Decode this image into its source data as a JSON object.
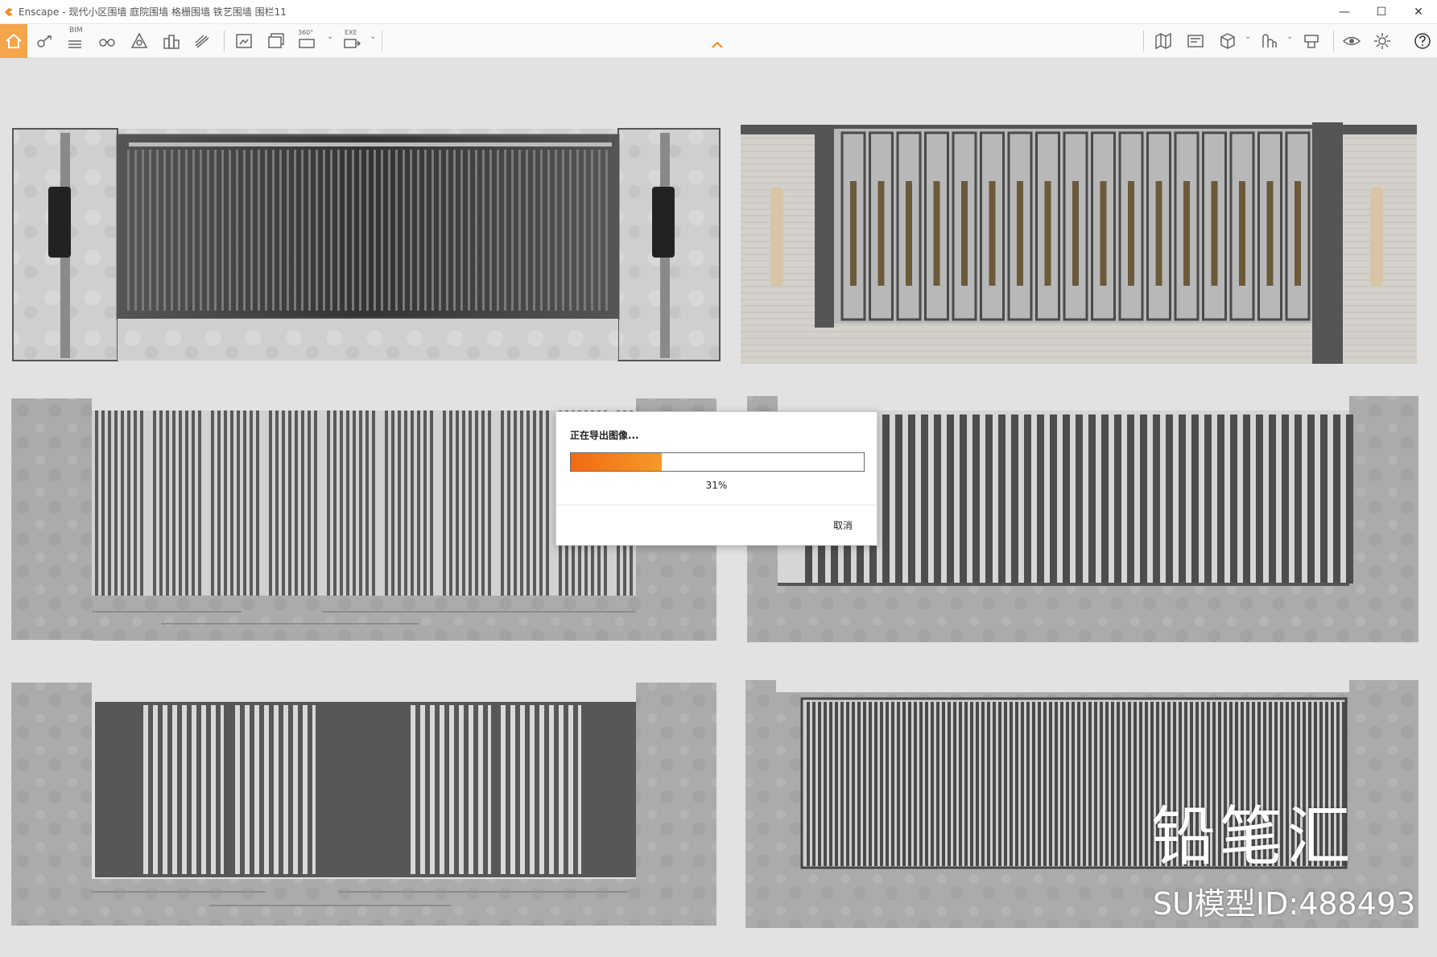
{
  "window": {
    "app_name": "Enscape",
    "title": "Enscape - 现代小区围墙 庭院围墙 格栅围墙 铁艺围墙 围栏11",
    "controls": {
      "minimize": "—",
      "maximize": "☐",
      "close": "✕"
    }
  },
  "toolbar": {
    "bim_label": "BIM",
    "panorama_label": "360°",
    "exe_label": "EXE",
    "icons": [
      "home-icon",
      "views-icon",
      "bim-icon",
      "binoculars-icon",
      "atmosphere-icon",
      "asset-library-icon",
      "material-editor-icon",
      "screenshot-icon",
      "batch-render-icon",
      "panorama-icon",
      "export-exe-icon",
      "map-icon",
      "minimap-icon",
      "cube-view-icon",
      "video-editor-icon",
      "collaborative-annotation-icon",
      "visual-settings-icon",
      "settings-icon",
      "help-icon"
    ]
  },
  "dialog": {
    "title": "正在导出图像...",
    "progress": 0.31,
    "progress_text": "31%",
    "cancel_label": "取消"
  },
  "watermark": {
    "brand": "铅笔汇",
    "model_id": "SU模型ID:488493"
  },
  "colors": {
    "accent": "#f5a64a",
    "progress": "#f26a12",
    "metal": "#4a4a4a",
    "stone": "#a9a9a9",
    "panel_bg": "#e2e2e2"
  }
}
